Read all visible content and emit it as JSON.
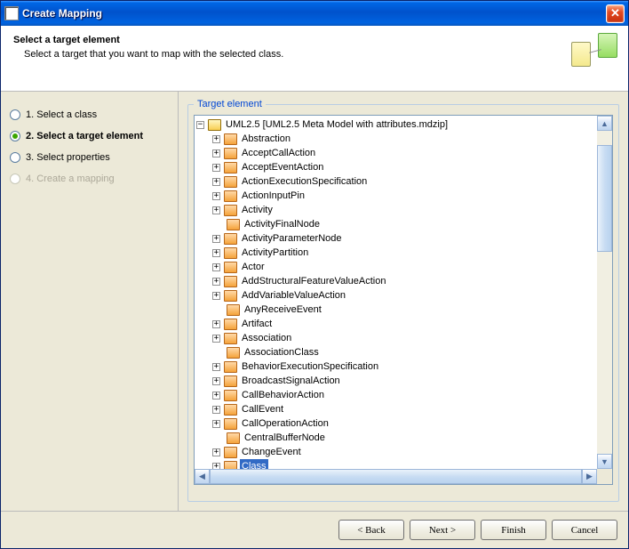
{
  "window": {
    "title": "Create Mapping"
  },
  "header": {
    "title": "Select a target element",
    "subtitle": "Select a target that you want to map with the selected class."
  },
  "steps": [
    {
      "label": "1. Select a class",
      "active": false,
      "disabled": false
    },
    {
      "label": "2. Select a target element",
      "active": true,
      "disabled": false
    },
    {
      "label": "3. Select properties",
      "active": false,
      "disabled": false
    },
    {
      "label": "4. Create a mapping",
      "active": false,
      "disabled": true
    }
  ],
  "panel": {
    "legend": "Target element",
    "root": {
      "label": "UML2.5 [UML2.5 Meta Model with attributes.mdzip]",
      "expandable": true,
      "expanded": true,
      "icon": "folder",
      "children": [
        {
          "label": "Abstraction",
          "expandable": true,
          "icon": "block"
        },
        {
          "label": "AcceptCallAction",
          "expandable": true,
          "icon": "block"
        },
        {
          "label": "AcceptEventAction",
          "expandable": true,
          "icon": "block"
        },
        {
          "label": "ActionExecutionSpecification",
          "expandable": true,
          "icon": "block"
        },
        {
          "label": "ActionInputPin",
          "expandable": true,
          "icon": "block"
        },
        {
          "label": "Activity",
          "expandable": true,
          "icon": "block"
        },
        {
          "label": "ActivityFinalNode",
          "expandable": false,
          "icon": "block"
        },
        {
          "label": "ActivityParameterNode",
          "expandable": true,
          "icon": "block"
        },
        {
          "label": "ActivityPartition",
          "expandable": true,
          "icon": "block"
        },
        {
          "label": "Actor",
          "expandable": true,
          "icon": "block"
        },
        {
          "label": "AddStructuralFeatureValueAction",
          "expandable": true,
          "icon": "block"
        },
        {
          "label": "AddVariableValueAction",
          "expandable": true,
          "icon": "block"
        },
        {
          "label": "AnyReceiveEvent",
          "expandable": false,
          "icon": "block"
        },
        {
          "label": "Artifact",
          "expandable": true,
          "icon": "block"
        },
        {
          "label": "Association",
          "expandable": true,
          "icon": "block"
        },
        {
          "label": "AssociationClass",
          "expandable": false,
          "icon": "block"
        },
        {
          "label": "BehaviorExecutionSpecification",
          "expandable": true,
          "icon": "block"
        },
        {
          "label": "BroadcastSignalAction",
          "expandable": true,
          "icon": "block"
        },
        {
          "label": "CallBehaviorAction",
          "expandable": true,
          "icon": "block"
        },
        {
          "label": "CallEvent",
          "expandable": true,
          "icon": "block"
        },
        {
          "label": "CallOperationAction",
          "expandable": true,
          "icon": "block"
        },
        {
          "label": "CentralBufferNode",
          "expandable": false,
          "icon": "block"
        },
        {
          "label": "ChangeEvent",
          "expandable": true,
          "icon": "block"
        },
        {
          "label": "Class",
          "expandable": true,
          "icon": "block",
          "selected": true
        }
      ]
    }
  },
  "footer": {
    "back": "< Back",
    "next": "Next >",
    "finish": "Finish",
    "cancel": "Cancel"
  }
}
